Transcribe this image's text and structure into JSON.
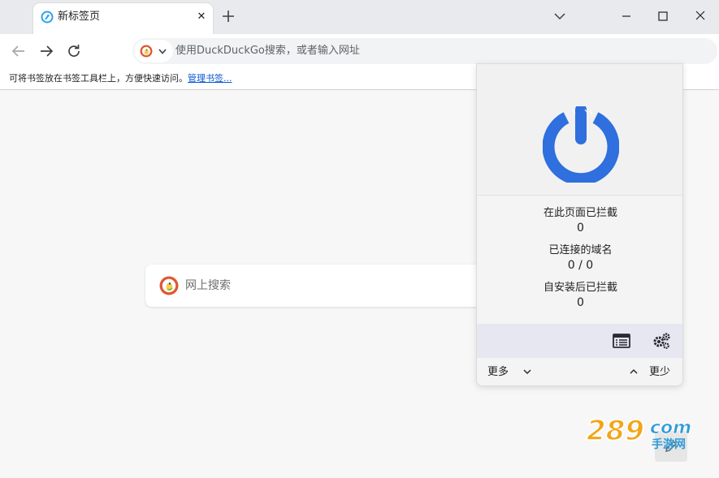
{
  "tab": {
    "title": "新标签页",
    "close_label": "✕"
  },
  "toolbar": {
    "omnibox_placeholder": "使用DuckDuckGo搜索，或者输入网址"
  },
  "bookmarks_bar": {
    "message": "可将书签放在书签工具栏上，方便快速访问。",
    "manage_link": "管理书签..."
  },
  "ntp": {
    "search_placeholder": "网上搜索"
  },
  "popup": {
    "stats": [
      {
        "label": "在此页面已拦截",
        "value": "0"
      },
      {
        "label": "已连接的域名",
        "value": "0 / 0"
      },
      {
        "label": "自安装后已拦截",
        "value": "0"
      }
    ],
    "more_label": "更多",
    "less_label": "更少"
  },
  "watermark": {
    "text": "289",
    "suffix": "com",
    "cn": "手游网"
  },
  "colors": {
    "power_blue": "#2f6fde",
    "accent_link": "#0b57d0",
    "tab_strip": "#e8eaed"
  },
  "icons": [
    "tab-favicon-icon",
    "close-icon",
    "plus-icon",
    "chevron-down-icon",
    "minimize-icon",
    "maximize-icon",
    "close-window-icon",
    "back-arrow-icon",
    "forward-arrow-icon",
    "reload-icon",
    "duckduckgo-icon",
    "power-icon",
    "list-icon",
    "gears-icon",
    "pencil-icon"
  ]
}
